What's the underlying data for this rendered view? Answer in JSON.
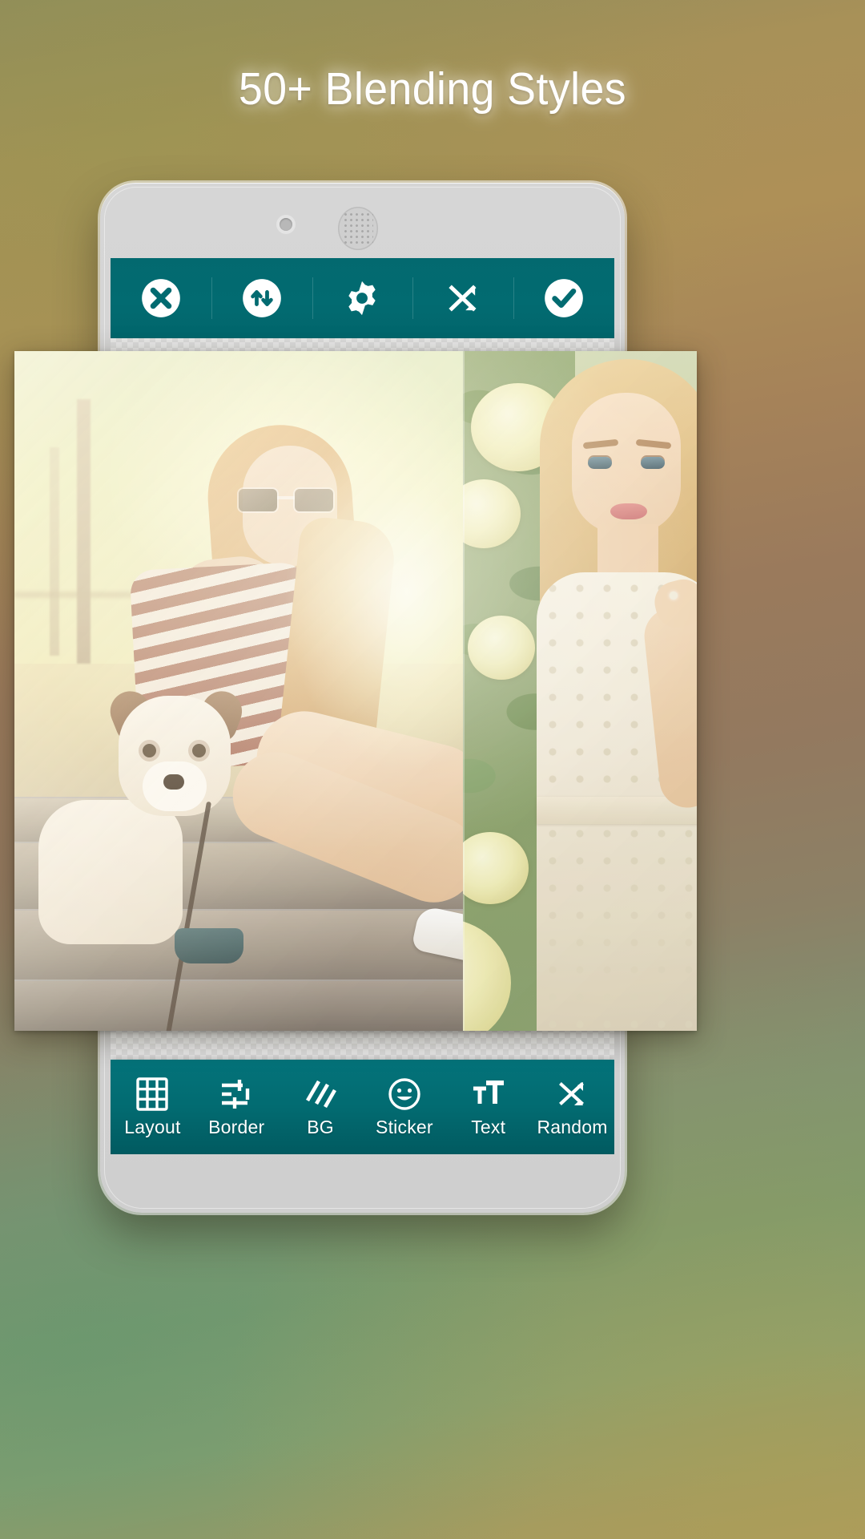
{
  "headline": {
    "text": "50+ Blending Styles"
  },
  "theme": {
    "toolbar_color": "#026b71",
    "toolbar_icon_color": "#ffffff",
    "phone_body_color": "#d4d4d4",
    "headline_color": "#ffffff",
    "background_top_color": "#ae9057",
    "background_bottom_color": "#7c9a6f"
  },
  "phone": {
    "camera": "front-camera",
    "speaker": "earpiece-speaker"
  },
  "top_toolbar": {
    "items": [
      {
        "icon": "close-circle-icon",
        "name": "close-button",
        "label": "Close"
      },
      {
        "icon": "swap-vertical-circle-icon",
        "name": "swap-button",
        "label": "Swap"
      },
      {
        "icon": "gear-icon",
        "name": "settings-button",
        "label": "Settings"
      },
      {
        "icon": "shuffle-icon",
        "name": "shuffle-button",
        "label": "Shuffle"
      },
      {
        "icon": "check-circle-icon",
        "name": "confirm-button",
        "label": "Done"
      }
    ]
  },
  "bottom_toolbar": {
    "items": [
      {
        "label": "Layout",
        "icon": "grid-icon",
        "name": "tab-layout"
      },
      {
        "label": "Border",
        "icon": "sliders-icon",
        "name": "tab-border"
      },
      {
        "label": "BG",
        "icon": "hatch-icon",
        "name": "tab-bg"
      },
      {
        "label": "Sticker",
        "icon": "smiley-icon",
        "name": "tab-sticker"
      },
      {
        "label": "Text",
        "icon": "text-size-icon",
        "name": "tab-text"
      },
      {
        "label": "Random",
        "icon": "shuffle-icon",
        "name": "tab-random"
      }
    ]
  },
  "canvas": {
    "name": "collage-canvas",
    "panes": [
      {
        "name": "collage-pane-left",
        "description": "Woman in striped top with sunglasses sitting on steps beside a Jack Russell terrier"
      },
      {
        "name": "collage-pane-right",
        "description": "Blonde woman in a white lace dress in front of white hydrangea blooms"
      }
    ]
  }
}
